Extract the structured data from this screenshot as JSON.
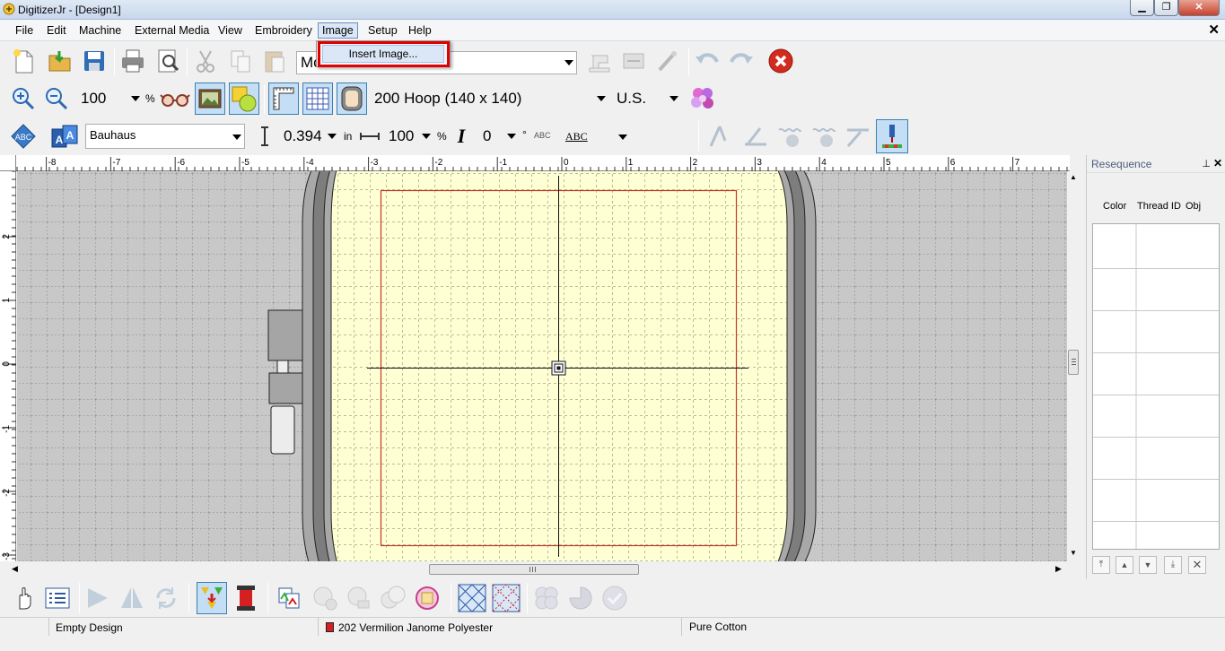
{
  "window": {
    "title": "DigitizerJr - [Design1]",
    "controls": [
      "minimize-icon",
      "restore-icon",
      "close-icon"
    ]
  },
  "menu": {
    "items": [
      "File",
      "Edit",
      "Machine",
      "External Media",
      "View",
      "Embroidery",
      "Image",
      "Setup",
      "Help"
    ],
    "open_menu": "Image",
    "dropdown_items": [
      "Insert Image..."
    ]
  },
  "toolbar1": {
    "mode_combo_value": "Mo",
    "icons": [
      "new-file-icon",
      "open-folder-icon",
      "save-icon",
      "print-icon",
      "print-preview-icon",
      "cut-icon",
      "copy-icon",
      "paste-icon",
      "sewing-machine-icon",
      "machine-transfer-icon",
      "wizard-icon",
      "undo-icon",
      "redo-icon",
      "stop-icon"
    ]
  },
  "toolbar2": {
    "zoom_value": "100",
    "zoom_unit": "%",
    "hoop_value": "200 Hoop (140 x 140)",
    "units_value": "U.S.",
    "icons": [
      "zoom-in-icon",
      "zoom-out-icon",
      "glasses-icon",
      "picture-icon",
      "background-color-icon",
      "hoop-ruler-icon",
      "grid-icon",
      "hoop-view-icon",
      "thread-palette-icon"
    ]
  },
  "toolbar3": {
    "font_value": "Bauhaus",
    "height_value": "0.394",
    "height_unit": "in",
    "width_value": "100",
    "width_unit": "%",
    "italic_label": "I",
    "angle_value": "0",
    "angle_unit": "°",
    "abc_small": "ABC",
    "abc_style": "ABC",
    "icons": [
      "circle-text-icon",
      "text-blocks-icon",
      "height-icon",
      "width-icon",
      "abc-icon",
      "text-path-icon",
      "stitch-sim-1-icon",
      "stitch-sim-2-icon",
      "stitch-sim-3-icon",
      "stitch-sim-4-icon",
      "stitch-sim-5-icon",
      "stitch-player-icon"
    ]
  },
  "ruler": {
    "top_labels": [
      "-8",
      "-7",
      "-6",
      "-5",
      "-4",
      "-3",
      "-2",
      "-1",
      "0",
      "1",
      "2",
      "3",
      "4",
      "5",
      "6",
      "7"
    ],
    "left_labels": [
      "2",
      "1",
      "0",
      "-1",
      "-2",
      "-3"
    ]
  },
  "resequence": {
    "title": "Resequence",
    "columns": [
      "Color",
      "Thread ID",
      "Obj"
    ],
    "buttons": [
      "move-top-icon",
      "move-up-icon",
      "move-down-icon",
      "move-bottom-icon",
      "delete-icon"
    ]
  },
  "bottom_toolbar": {
    "icons": [
      "hand-icon",
      "checklist-icon",
      "flip-horizontal-icon",
      "flip-vertical-icon",
      "rotate-icon",
      "color-sort-icon",
      "thread-spool-icon",
      "applique-icon",
      "add-circle-icon",
      "remove-circle-icon",
      "merge-icon",
      "color-wheel-icon",
      "fill-pattern-1-icon",
      "fill-pattern-2-icon",
      "combine-icon",
      "pie-icon",
      "check-icon"
    ]
  },
  "status": {
    "design_state": "Empty Design",
    "thread": "202 Vermilion Janome Polyester",
    "fabric": "Pure Cotton"
  },
  "colors": {
    "hoop_fill": "#ffffd4",
    "canvas_bg": "#c8c8c8",
    "design_area_border": "#c0392b",
    "highlight": "#e00000"
  }
}
